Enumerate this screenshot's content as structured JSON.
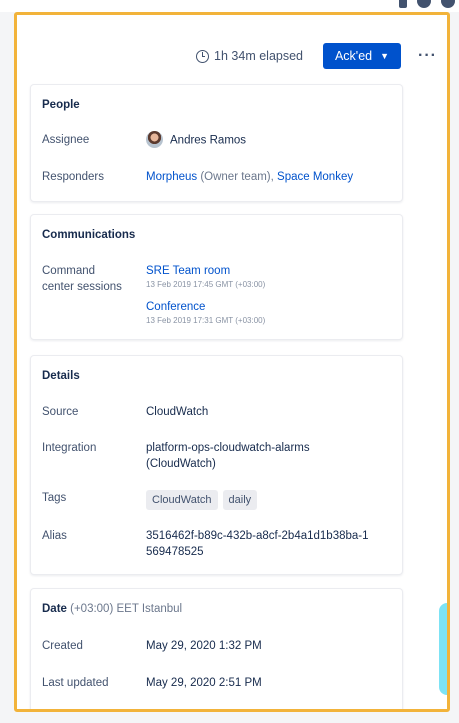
{
  "header": {
    "elapsed": "1h 34m elapsed",
    "ack_label": "Ack'ed",
    "more": "···"
  },
  "people": {
    "title": "People",
    "assignee_label": "Assignee",
    "assignee": "Andres Ramos",
    "responders_label": "Responders",
    "responder1": "Morpheus",
    "responder1_note": " (Owner team), ",
    "responder2": "Space Monkey"
  },
  "communications": {
    "title": "Communications",
    "sessions_label_line1": "Command",
    "sessions_label_line2": "center sessions",
    "sessions": [
      {
        "name": "SRE Team room",
        "time": "13 Feb 2019 17:45 GMT (+03:00)"
      },
      {
        "name": "Conference",
        "time": "13 Feb 2019 17:31 GMT (+03:00)"
      }
    ]
  },
  "details": {
    "title": "Details",
    "source_label": "Source",
    "source": "CloudWatch",
    "integration_label": "Integration",
    "integration_line1": "platform-ops-cloudwatch-alarms",
    "integration_line2": "(CloudWatch)",
    "tags_label": "Tags",
    "tags": [
      "CloudWatch",
      "daily"
    ],
    "alias_label": "Alias",
    "alias_line1": "3516462f-b89c-432b-a8cf-2b4a1d1b38ba-1",
    "alias_line2": "569478525"
  },
  "date": {
    "title": "Date",
    "timezone": " (+03:00) EET Istanbul",
    "created_label": "Created",
    "created": "May 29, 2020 1:32 PM",
    "updated_label": "Last updated",
    "updated": "May 29, 2020 2:51 PM"
  },
  "colors": {
    "frame_highlight": "#f2b33a",
    "primary": "#0052cc"
  }
}
